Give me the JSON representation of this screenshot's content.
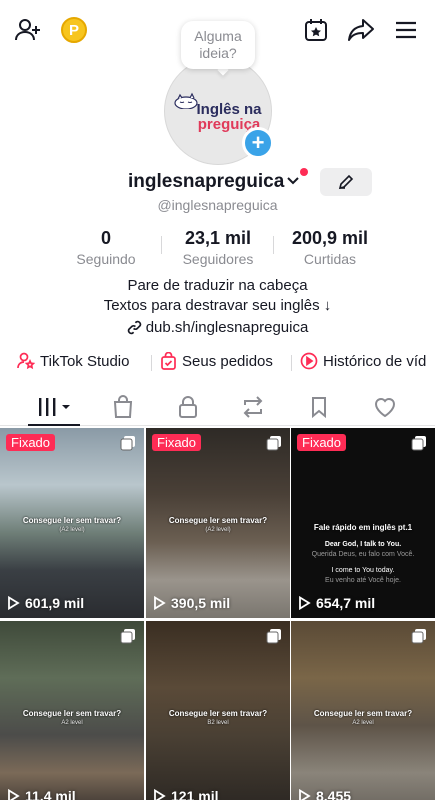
{
  "header": {
    "coin_label": "P",
    "bubble_text": "Alguma ideia?"
  },
  "logo": {
    "line1": "Inglês na",
    "line2": "preguiça"
  },
  "profile": {
    "username": "inglesnapreguica",
    "handle": "@inglesnapreguica"
  },
  "stats": [
    {
      "value": "0",
      "label": "Seguindo"
    },
    {
      "value": "23,1 mil",
      "label": "Seguidores"
    },
    {
      "value": "200,9 mil",
      "label": "Curtidas"
    }
  ],
  "bio": {
    "line1": "Pare de traduzir na cabeça",
    "line2": "Textos para destravar seu inglês ↓",
    "link": "dub.sh/inglesnapreguica"
  },
  "quick_links": [
    {
      "label": "TikTok Studio"
    },
    {
      "label": "Seus pedidos"
    },
    {
      "label": "Histórico de víd"
    }
  ],
  "videos": [
    {
      "pinned": "Fixado",
      "caption": "Consegue ler sem travar?",
      "sub": "(A2 level)",
      "views": "601,9 mil"
    },
    {
      "pinned": "Fixado",
      "caption": "Consegue ler sem travar?",
      "sub": "(A2 level)",
      "views": "390,5 mil"
    },
    {
      "pinned": "Fixado",
      "caption": "Fale rápido em inglês pt.1",
      "sub": "Dear God, I talk to You.",
      "views": "654,7 mil"
    },
    {
      "pinned": "",
      "caption": "Consegue ler sem travar?",
      "sub": "A2 level",
      "views": "11,4 mil"
    },
    {
      "pinned": "",
      "caption": "Consegue ler sem travar?",
      "sub": "B2 level",
      "views": "121 mil"
    },
    {
      "pinned": "",
      "caption": "Consegue ler sem travar?",
      "sub": "A2 level",
      "views": "8.455"
    }
  ],
  "dark_video_lines": [
    "Querida Deus, eu falo com Você.",
    "I come to You today.",
    "Eu venho até Você hoje."
  ],
  "colors": {
    "accent": "#fe2c55",
    "plus": "#3aa3e8",
    "coin": "#f7c51e"
  }
}
